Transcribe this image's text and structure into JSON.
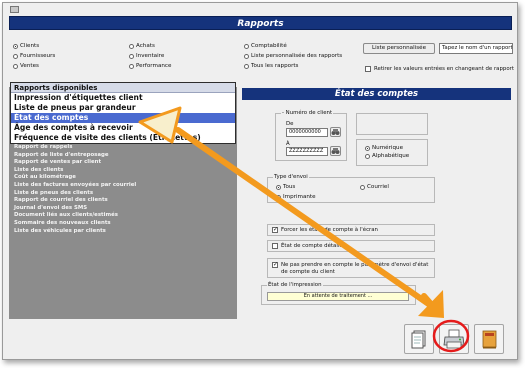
{
  "window": {
    "title": "Rapports"
  },
  "report_types": [
    {
      "label": "Clients",
      "selected": true
    },
    {
      "label": "Achats",
      "selected": false
    },
    {
      "label": "Comptabilité",
      "selected": false
    },
    {
      "label": "Fournisseurs",
      "selected": false
    },
    {
      "label": "Inventaire",
      "selected": false
    },
    {
      "label": "Liste personnalisée des rapports",
      "selected": false
    },
    {
      "label": "Ventes",
      "selected": false
    },
    {
      "label": "Performance",
      "selected": false
    },
    {
      "label": "Tous les rapports",
      "selected": false
    }
  ],
  "custom_list": {
    "button_label": "Liste personnalisée",
    "report_name_value": "Tapez le nom d'un rapport"
  },
  "remove_values_label": "Retirer les valeurs entrées en changeant de rapport",
  "dropdown": {
    "header": "Rapports disponibles",
    "items": [
      "Impression d'étiquettes client",
      "Liste de pneus par grandeur",
      "État des comptes",
      "Âge des comptes à recevoir",
      "Fréquence de visite des clients (Étiquettes)"
    ],
    "selected_index": 2
  },
  "report_list": [
    "Rapport de rappels",
    "Rapport de liste d'entreposage",
    "Rapport de ventes par client",
    "Liste des clients",
    "Coût au kilométrage",
    "Liste des factures envoyées par courriel",
    "Liste de pneus des clients",
    "Rapport de courriel des clients",
    "Journal d'envoi des SMS",
    "Document liés aux clients/estimés",
    "Sommaire des nouveaux clients",
    "Liste des véhicules par clients"
  ],
  "report_title": "État des comptes",
  "client_number": {
    "group_label": "Numéro de client",
    "from_label": "De",
    "from_value": "0000000000",
    "to_label": "À",
    "to_value": "ZZZZZZZZZZ"
  },
  "sort_options": [
    {
      "label": "Numérique",
      "selected": true
    },
    {
      "label": "Alphabétique",
      "selected": false
    }
  ],
  "send_type": {
    "group_label": "Type d'envoi",
    "options": [
      {
        "label": "Tous",
        "selected": true
      },
      {
        "label": "Courriel",
        "selected": false
      },
      {
        "label": "Imprimante",
        "selected": false
      }
    ]
  },
  "checkboxes": [
    {
      "label": "Forcer les états de compte à l'écran",
      "checked": true
    },
    {
      "label": "État de compte détaillé",
      "checked": false
    },
    {
      "label": "Ne pas prendre en compte le paramètre d'envoi d'état de compte du client",
      "checked": true
    }
  ],
  "print_status": {
    "group_label": "État de l'impression",
    "value": "En attente de traitement ..."
  },
  "action_icons": [
    "preview-icon",
    "printer-icon",
    "export-icon"
  ],
  "colors": {
    "title_bar": "#15337c",
    "selection": "#4a6ad0",
    "arrow": "#f39a1e",
    "panel": "#8c8c8c"
  }
}
